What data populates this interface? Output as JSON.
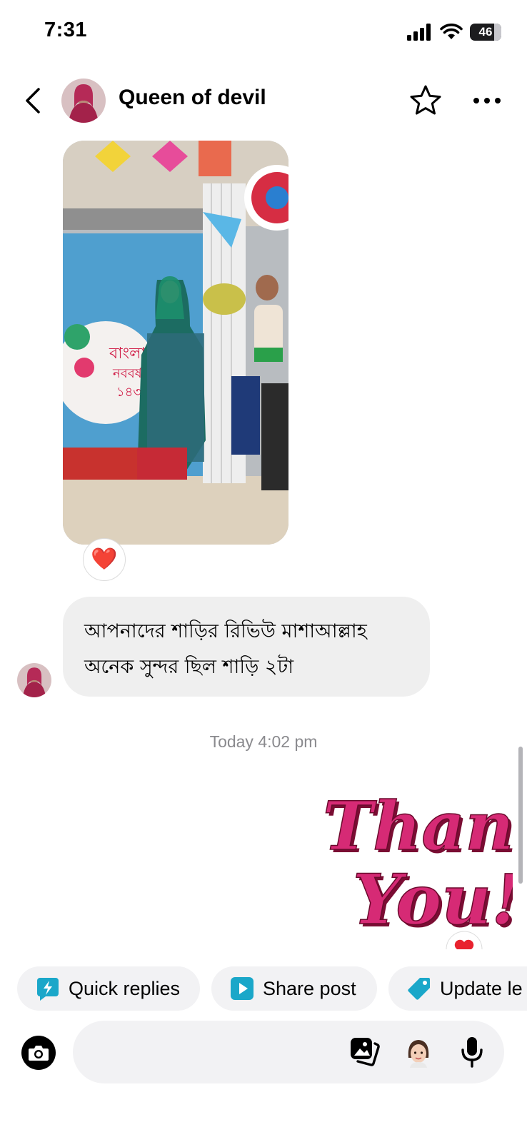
{
  "status_bar": {
    "time": "7:31",
    "battery": "46",
    "icons": [
      "cellular-signal-icon",
      "wifi-icon",
      "battery-icon"
    ]
  },
  "header": {
    "contact_name": "Queen of devil",
    "icons": [
      "back-arrow-icon",
      "star-icon",
      "more-dots-icon"
    ]
  },
  "messages": [
    {
      "type": "media",
      "sender": "contact",
      "reaction": "❤️"
    },
    {
      "type": "text",
      "sender": "contact",
      "lines": [
        "আপনাদের শাড়ির রিভিউ মাশাআল্লাহ",
        "অনেক সুন্দর ছিল শাড়ি ২টা"
      ]
    }
  ],
  "timestamp": "Today 4:02 pm",
  "sticker": {
    "line1": "Thank",
    "line2": "You!",
    "reaction": "❤️"
  },
  "quick_actions": [
    {
      "label": "Quick replies",
      "icon": "lightning-chat-icon"
    },
    {
      "label": "Share post",
      "icon": "play-icon"
    },
    {
      "label": "Update le",
      "icon": "tag-icon"
    }
  ],
  "composer": {
    "placeholder": "",
    "icons": [
      "camera-icon",
      "gallery-icon",
      "avatar-sticker-icon",
      "microphone-icon"
    ]
  },
  "colors": {
    "bubble_bg": "#efefef",
    "chip_bg": "#f2f2f4",
    "chip_icon": "#1aa7c9",
    "timestamp": "#8a8a8e",
    "sticker_text": "#c8165e"
  }
}
